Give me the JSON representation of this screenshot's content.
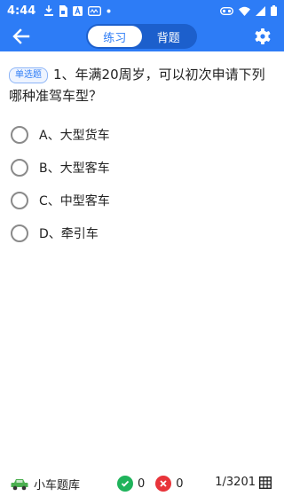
{
  "status_bar": {
    "time": "4:44",
    "icons_left": [
      "download-icon",
      "sim-icon",
      "a-icon",
      "card-icon",
      "dot-icon"
    ],
    "icons_right": [
      "cast-icon",
      "wifi-icon",
      "signal-icon",
      "battery-icon"
    ]
  },
  "header": {
    "tabs": [
      {
        "label": "练习",
        "active": true
      },
      {
        "label": "背题",
        "active": false
      }
    ]
  },
  "question": {
    "type_badge": "单选题",
    "text": "1、年满20周岁，可以初次申请下列哪种准驾车型？"
  },
  "options": [
    {
      "label": "A、大型货车"
    },
    {
      "label": "B、大型客车"
    },
    {
      "label": "C、中型客车"
    },
    {
      "label": "D、牵引车"
    }
  ],
  "footer": {
    "bank_label": "小车题库",
    "correct_count": "0",
    "wrong_count": "0",
    "progress": "1/3201"
  },
  "colors": {
    "primary": "#2d7cf6",
    "correct": "#1fb35b",
    "wrong": "#e8343a"
  }
}
